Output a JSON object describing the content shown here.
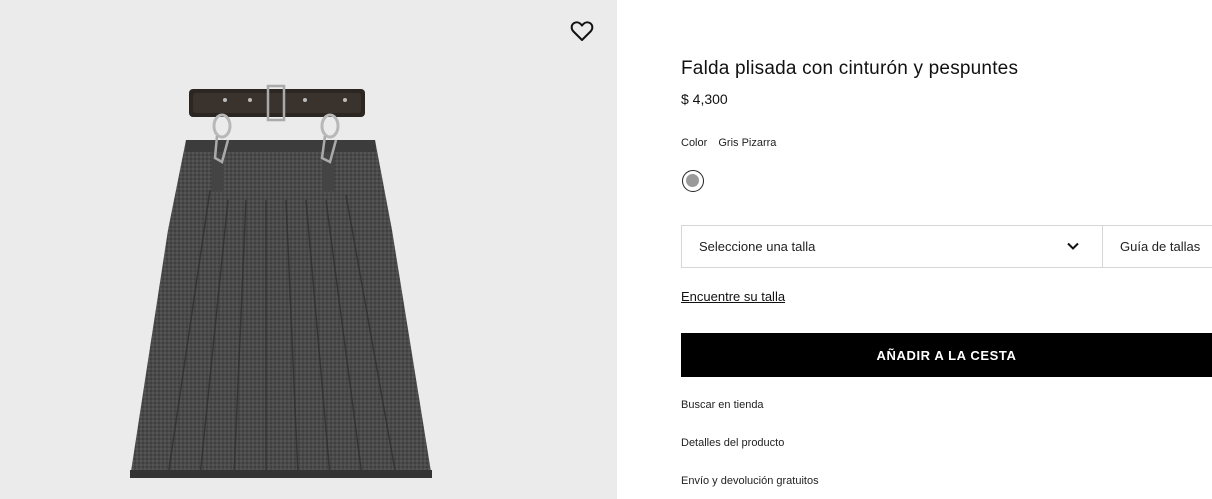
{
  "product": {
    "title": "Falda plisada con cinturón y pespuntes",
    "price": "$ 4,300",
    "color_label": "Color",
    "color_value": "Gris Pizarra",
    "swatch_color": "#9a9a9a"
  },
  "size": {
    "select_label": "Seleccione una talla",
    "guide_label": "Guía de tallas"
  },
  "find_size_label": "Encuentre su talla",
  "add_to_cart_label": "AÑADIR A LA CESTA",
  "links": {
    "store": "Buscar en tienda",
    "details": "Detalles del producto",
    "shipping": "Envío y devolución gratuitos"
  },
  "icons": {
    "favorite": "heart-icon",
    "dropdown": "chevron-down-icon"
  }
}
